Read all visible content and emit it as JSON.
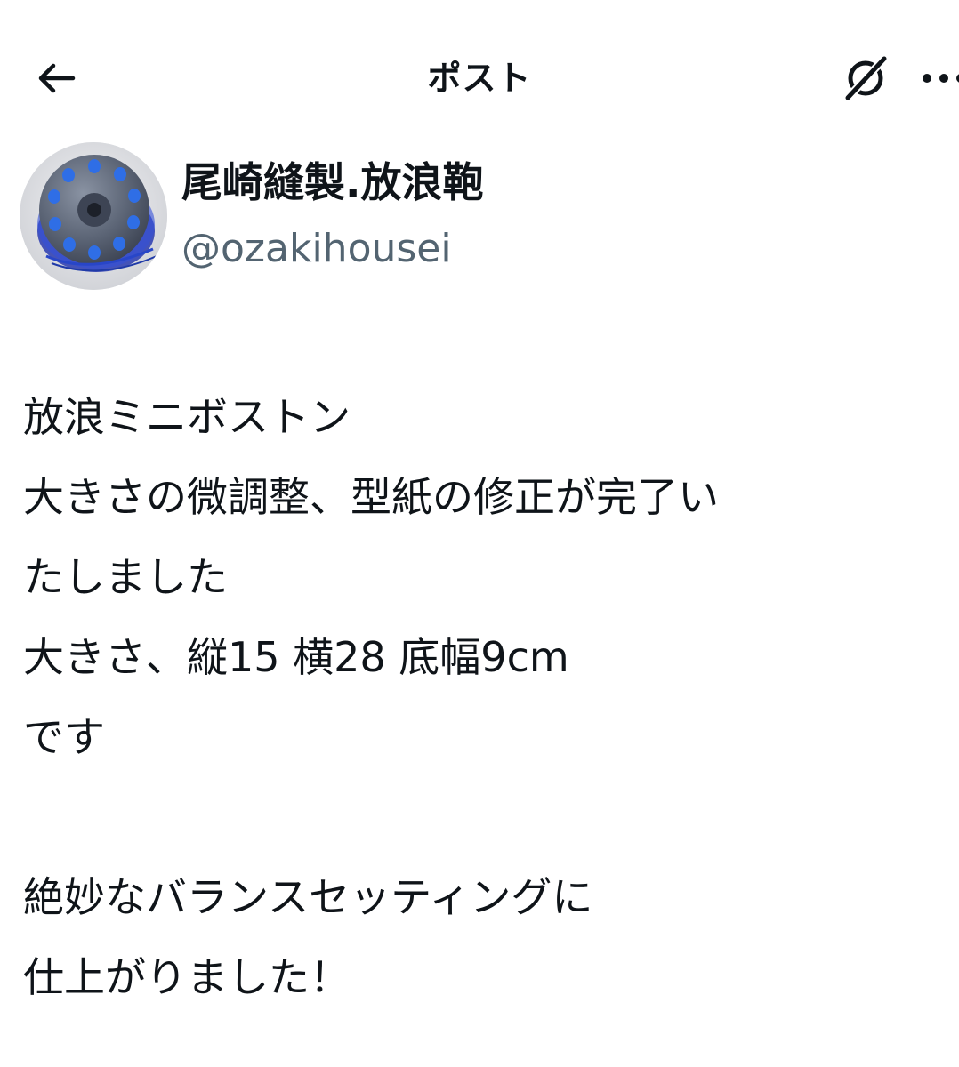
{
  "header": {
    "title": "ポスト",
    "back_icon": "arrow-left-icon",
    "grok_icon": "grok-icon",
    "more_icon": "more-horizontal-icon"
  },
  "author": {
    "name": "尾崎縫製.放浪鞄",
    "handle": "@ozakihousei",
    "avatar_icon": "sewing-bobbin-avatar"
  },
  "post": {
    "lines": [
      "放浪ミニボストン",
      "大きさの微調整、型紙の修正が完了い",
      "たしました",
      "大きさ、縦15 横28 底幅9cm",
      "です",
      "",
      "絶妙なバランスセッティングに",
      "仕上がりました！"
    ]
  },
  "colors": {
    "text": "#0f1419",
    "secondary_text": "#536471",
    "background": "#ffffff",
    "avatar_accent": "#2f5fd0"
  }
}
